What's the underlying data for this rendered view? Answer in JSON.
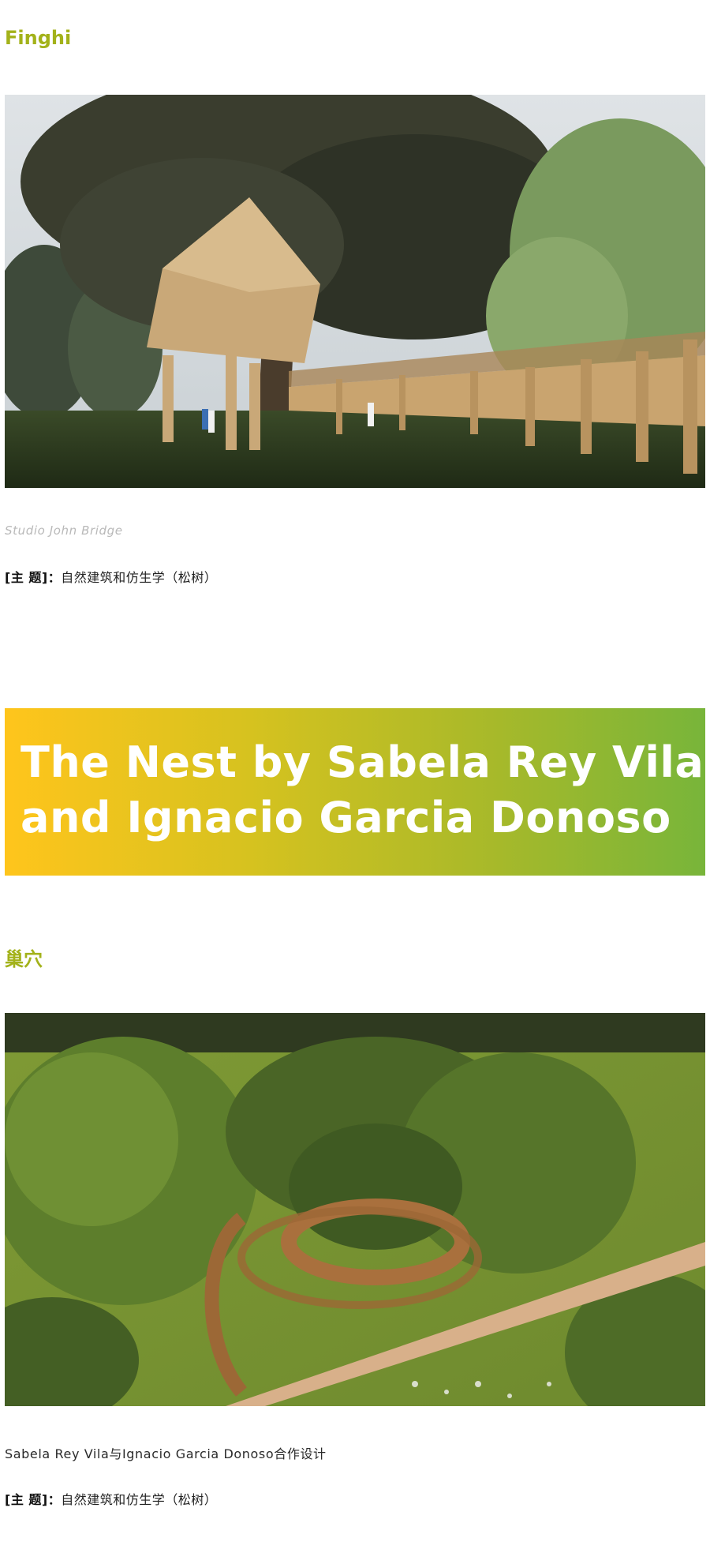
{
  "section1": {
    "title": "Finghi",
    "photo_caption": "Studio John Bridge",
    "topic_label": "[主 题]：",
    "topic_value": "自然建筑和仿生学（松树）"
  },
  "banner": {
    "line1": "The Nest by Sabela Rey Vila",
    "line2": "and Ignacio Garcia Donoso",
    "colors": [
      "#ffc51c",
      "#78b53a"
    ]
  },
  "section2": {
    "title": "巢穴",
    "photo_caption": "Sabela Rey Vila与Ignacio Garcia Donoso合作设计",
    "topic_label": "[主 题]：",
    "topic_value": "自然建筑和仿生学（松树）"
  },
  "colors": {
    "accent_title": "#a3b21a",
    "caption_grey": "#b9b9b9"
  }
}
